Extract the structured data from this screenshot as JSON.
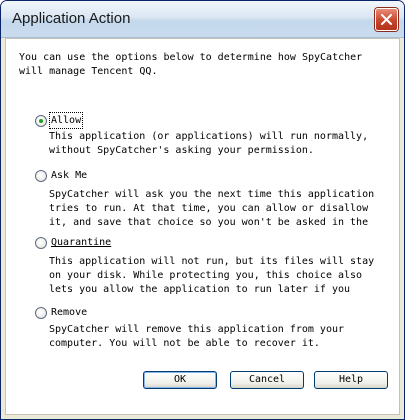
{
  "window": {
    "title": "Application Action",
    "close_glyph": "×"
  },
  "intro_text": "You can use the options below to determine how SpyCatcher will manage Tencent QQ.",
  "options": [
    {
      "label": "Allow",
      "checked": true,
      "description": "This application (or applications) will run normally, without SpyCatcher's asking your permission."
    },
    {
      "label": "Ask Me",
      "checked": false,
      "description": "SpyCatcher will ask you the next time this application tries to run.  At that time, you can allow or disallow it, and save that choice so you won't be asked in the future if you wish."
    },
    {
      "label": "Quarantine",
      "checked": false,
      "description": "This application will not run, but its files will stay on your disk.  While protecting you, this choice also lets you allow the application to run later if you change your mind."
    },
    {
      "label": "Remove",
      "checked": false,
      "description": "SpyCatcher will remove this application from your computer.  You will not be able to recover it."
    }
  ],
  "buttons": {
    "ok": "OK",
    "cancel": "Cancel",
    "help": "Help"
  },
  "icons": {
    "close": "close-icon",
    "radio_selected": "radio-selected-icon"
  },
  "colors": {
    "titlebar": "#c9dcef",
    "close_button": "#c9452c",
    "radio_dot": "#21a121",
    "button_border": "#003c74"
  }
}
